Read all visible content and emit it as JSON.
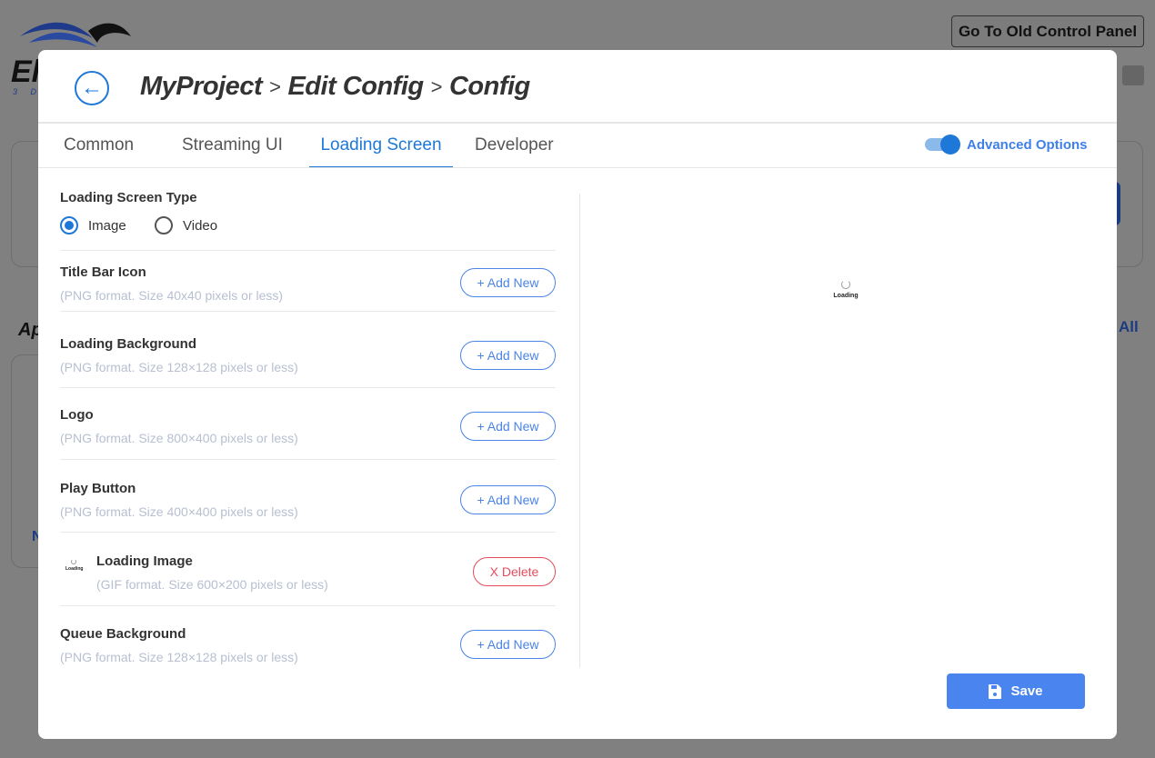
{
  "background": {
    "old_panel_button": "Go To Old Control Panel",
    "logo_letters": "El",
    "logo_sub": "3 D",
    "section_title_partial": "Ap",
    "view_all_partial": "All",
    "card_partial": "N"
  },
  "header": {
    "breadcrumbs": [
      "MyProject",
      "Edit Config",
      "Config"
    ],
    "separator": ">"
  },
  "tabs": [
    {
      "label": "Common",
      "active": false
    },
    {
      "label": "Streaming UI",
      "active": false
    },
    {
      "label": "Loading Screen",
      "active": true
    },
    {
      "label": "Developer",
      "active": false
    }
  ],
  "advanced_options": {
    "label": "Advanced Options",
    "enabled": true
  },
  "loading_screen_type": {
    "label": "Loading Screen Type",
    "options": [
      "Image",
      "Video"
    ],
    "selected": "Image"
  },
  "assets": [
    {
      "title": "Title Bar Icon",
      "hint": "(PNG format. Size 40x40 pixels or less)",
      "action": "+ Add New"
    },
    {
      "title": "Loading Background",
      "hint": "(PNG format. Size 128×128 pixels or less)",
      "action": "+ Add New"
    },
    {
      "title": "Logo",
      "hint": "(PNG format. Size 800×400 pixels or less)",
      "action": "+ Add New"
    },
    {
      "title": "Play Button",
      "hint": "(PNG format. Size 400×400 pixels or less)",
      "action": "+ Add New"
    },
    {
      "title": "Loading Image",
      "hint": "(GIF format. Size 600×200 pixels or less)",
      "action": "X Delete",
      "thumb_text": "Loading"
    },
    {
      "title": "Queue Background",
      "hint": "(PNG format. Size 128×128 pixels or less)",
      "action": "+ Add New"
    }
  ],
  "preview": {
    "text": "Loading"
  },
  "save_label": "Save",
  "colors": {
    "accent": "#1e78d8",
    "button": "#4a84ef",
    "danger": "#e44c5c"
  }
}
